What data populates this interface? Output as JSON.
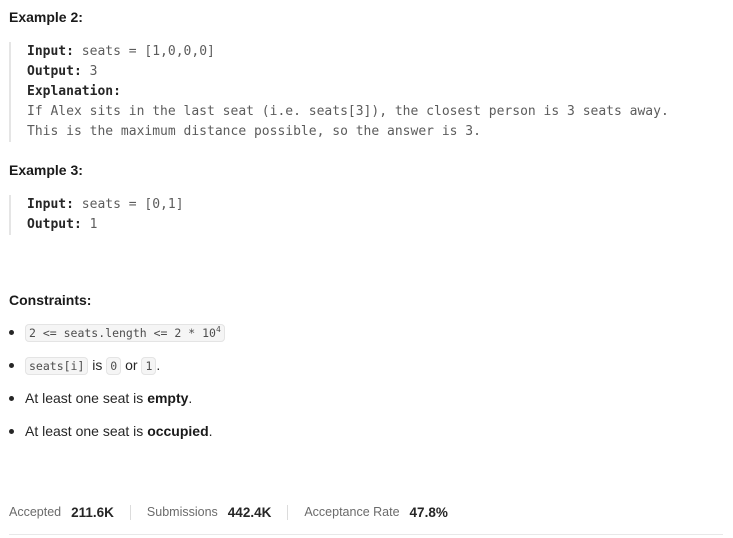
{
  "example2": {
    "title": "Example 2:",
    "input_label": "Input:",
    "input_value": " seats = [1,0,0,0]",
    "output_label": "Output:",
    "output_value": " 3",
    "explanation_label": "Explanation:",
    "explanation_lines": [
      "If Alex sits in the last seat (i.e. seats[3]), the closest person is 3 seats away.",
      "This is the maximum distance possible, so the answer is 3."
    ]
  },
  "example3": {
    "title": "Example 3:",
    "input_label": "Input:",
    "input_value": " seats = [0,1]",
    "output_label": "Output:",
    "output_value": " 1"
  },
  "constraints": {
    "title": "Constraints:",
    "c1_code": "2 <= seats.length <= 2 * 10",
    "c1_sup": "4",
    "c2_code_a": "seats[i]",
    "c2_text_a": " is ",
    "c2_code_b": "0",
    "c2_text_b": " or ",
    "c2_code_c": "1",
    "c2_text_c": ".",
    "c3_text": "At least one seat is ",
    "c3_bold": "empty",
    "c3_end": ".",
    "c4_text": "At least one seat is ",
    "c4_bold": "occupied",
    "c4_end": "."
  },
  "stats": {
    "accepted_label": "Accepted",
    "accepted_value": "211.6K",
    "submissions_label": "Submissions",
    "submissions_value": "442.4K",
    "rate_label": "Acceptance Rate",
    "rate_value": "47.8%"
  }
}
